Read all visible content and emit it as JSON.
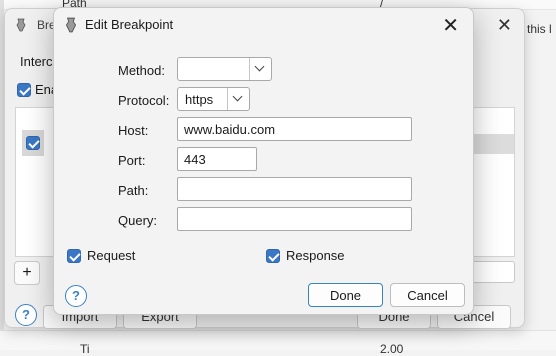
{
  "background": {
    "col_path": "Path",
    "col_slash": "/",
    "overflow_text": "this l",
    "bottom_left": "Ti",
    "bottom_right": "2.00"
  },
  "parent_dialog": {
    "title": "Bre",
    "intercept_label": "Interc",
    "enable_label": "Ena",
    "add_button": "+",
    "help": "?",
    "import_button": "Import",
    "export_button": "Export",
    "done_button": "Done",
    "cancel_button": "Cancel"
  },
  "dialog": {
    "title": "Edit Breakpoint",
    "close": "✕",
    "method_label": "Method:",
    "method_value": "",
    "protocol_label": "Protocol:",
    "protocol_value": "https",
    "host_label": "Host:",
    "host_value": "www.baidu.com",
    "port_label": "Port:",
    "port_value": "443",
    "path_label": "Path:",
    "path_value": "",
    "query_label": "Query:",
    "query_value": "",
    "request_label": "Request",
    "response_label": "Response",
    "help": "?",
    "done_button": "Done",
    "cancel_button": "Cancel"
  },
  "colors": {
    "accent": "#3a78c5",
    "focus_border": "#3b82c4"
  },
  "icons": {
    "app_icon": "app-icon",
    "close_icon": "close-icon",
    "help_icon": "help-icon",
    "dropdown_icon": "chevron-down-icon"
  }
}
